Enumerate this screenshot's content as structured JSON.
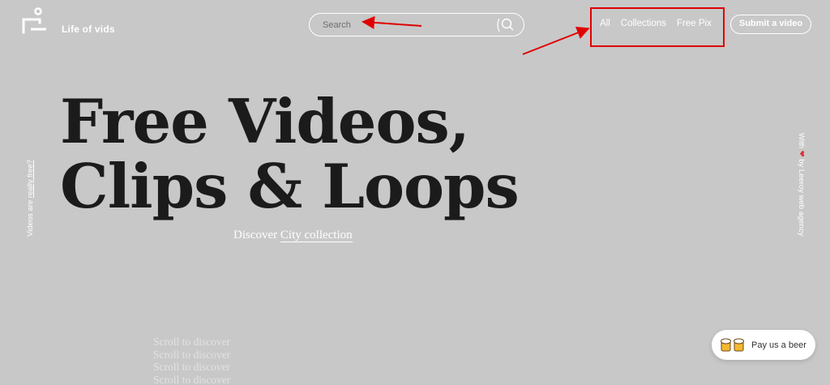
{
  "header": {
    "brand": "Life of vids",
    "logo_icon": "life-of-vids-logo-icon",
    "search": {
      "placeholder": "Search",
      "value": "",
      "icon": "search-icon"
    },
    "nav": [
      "All",
      "Collections",
      "Free Pix"
    ],
    "submit_label": "Submit a video"
  },
  "hero": {
    "line1": "Free Videos,",
    "line2": "Clips & Loops",
    "discover_prefix": "Discover",
    "discover_link": "City collection"
  },
  "side_left": {
    "prefix": "Videos are",
    "link": "really free?"
  },
  "side_right": {
    "with": "With",
    "by": "by Leeroy web",
    "agency": "agency",
    "heart_icon": "heart-icon"
  },
  "scroll_text": [
    "Scroll to discover",
    "Scroll to discover",
    "Scroll to discover",
    "Scroll to discover"
  ],
  "beer_button": {
    "label": "Pay us a beer",
    "icon": "beer-mugs-icon"
  },
  "colors": {
    "background": "#c8c8c8",
    "hero_text": "#1b1b1b",
    "annotation": "#e00000",
    "heart": "#e03030"
  }
}
